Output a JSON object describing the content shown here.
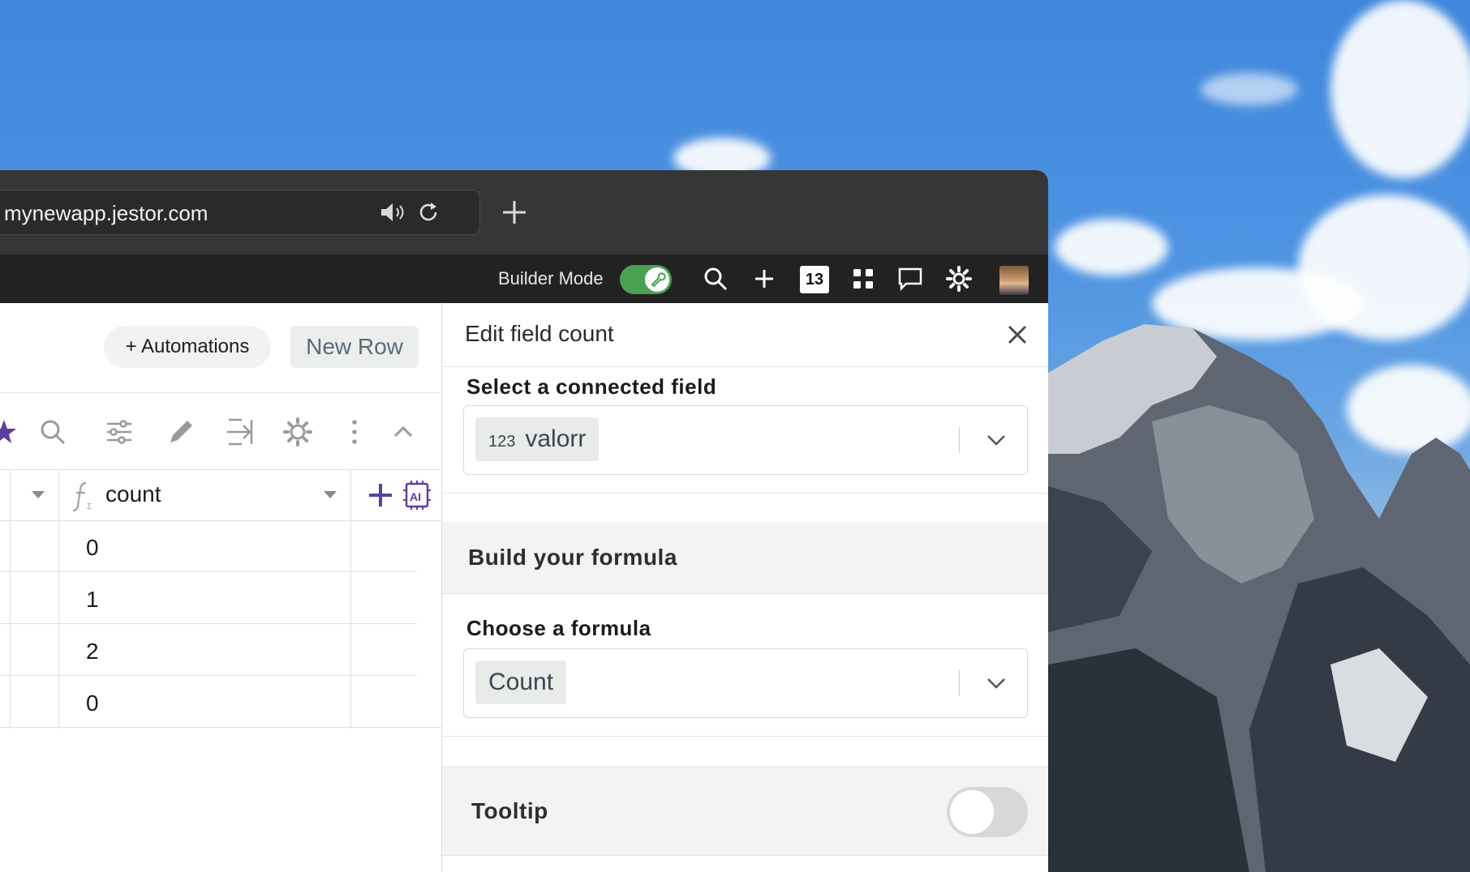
{
  "browser": {
    "url": "mynewapp.jestor.com"
  },
  "appbar": {
    "builder_mode_label": "Builder Mode",
    "builder_mode_on": true,
    "notification_count": "13"
  },
  "table": {
    "automations_label": "+ Automations",
    "new_row_label": "New Row",
    "column_name": "count",
    "rows": [
      "0",
      "1",
      "2",
      "0"
    ]
  },
  "edit_panel": {
    "title": "Edit field count",
    "connected_field_label": "Select a connected field",
    "connected_field_type": "123",
    "connected_field_value": "valorr",
    "build_formula_label": "Build your formula",
    "choose_formula_label": "Choose a formula",
    "formula_value": "Count",
    "tooltip_label": "Tooltip",
    "tooltip_on": false
  },
  "colors": {
    "toggle_on": "#4aa152",
    "accent_purple": "#5b3fa0",
    "tabbar_bg": "#363636",
    "appbar_bg": "#222222"
  }
}
